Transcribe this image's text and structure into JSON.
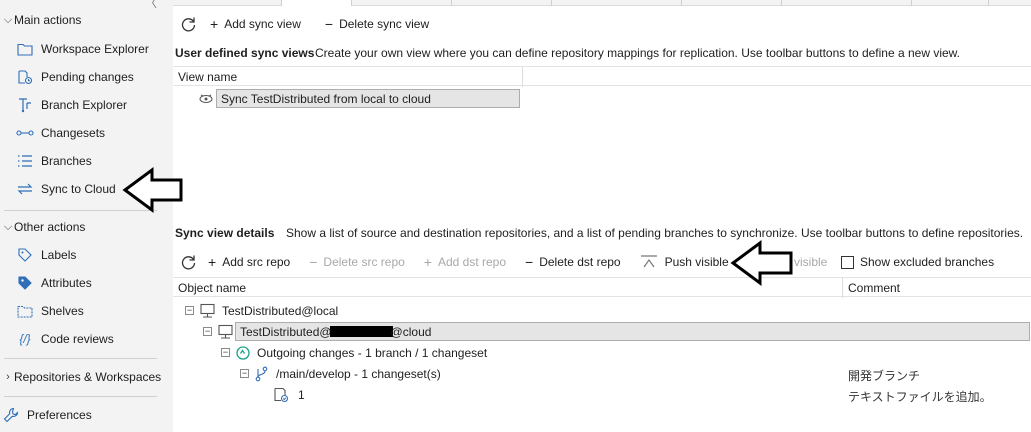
{
  "sidebar": {
    "main_actions_label": "Main actions",
    "main_items": [
      {
        "label": "Workspace Explorer",
        "icon": "folder-icon"
      },
      {
        "label": "Pending changes",
        "icon": "pending-changes-icon"
      },
      {
        "label": "Branch Explorer",
        "icon": "branch-explorer-icon"
      },
      {
        "label": "Changesets",
        "icon": "changesets-icon"
      },
      {
        "label": "Branches",
        "icon": "branches-list-icon"
      },
      {
        "label": "Sync to Cloud",
        "icon": "sync-icon"
      }
    ],
    "other_actions_label": "Other actions",
    "other_items": [
      {
        "label": "Labels",
        "icon": "label-tag-icon"
      },
      {
        "label": "Attributes",
        "icon": "attributes-tag-icon"
      },
      {
        "label": "Shelves",
        "icon": "shelves-icon"
      },
      {
        "label": "Code reviews",
        "icon": "code-review-icon"
      }
    ],
    "repos_label": "Repositories & Workspaces",
    "preferences_label": "Preferences"
  },
  "top_toolbar": {
    "add_sync_view": "Add sync view",
    "delete_sync_view": "Delete sync view"
  },
  "user_views": {
    "title": "User defined sync views",
    "description": "Create your own view where you can define repository mappings for replication. Use toolbar buttons to define a new view.",
    "column_header": "View name",
    "rows": [
      "Sync TestDistributed from local to cloud"
    ]
  },
  "details": {
    "title": "Sync view details",
    "description": "Show a list of source and destination repositories, and a list of pending branches to synchronize. Use toolbar buttons to define repositories.",
    "toolbar": {
      "add_src_repo": "Add src repo",
      "delete_src_repo": "Delete src repo",
      "add_dst_repo": "Add dst repo",
      "delete_dst_repo": "Delete dst repo",
      "push_visible": "Push visible",
      "pull_visible_fragment": "visible",
      "show_excluded_branches": "Show excluded branches"
    },
    "columns": {
      "object_name": "Object name",
      "comment": "Comment"
    },
    "tree": {
      "src_repo": "TestDistributed@local",
      "dst_repo_prefix": "TestDistributed@",
      "dst_repo_suffix": "@cloud",
      "outgoing": "Outgoing changes - 1 branch / 1 changeset",
      "branch": "/main/develop - 1 changeset(s)",
      "branch_comment": "開発ブランチ",
      "changeset": "1",
      "changeset_comment": "テキストファイルを追加。"
    }
  },
  "colors": {
    "sidebar_bg": "#f3f3f3",
    "selection_bg": "#e5e5e5",
    "accent_teal": "#18a38a",
    "icon_blue": "#2f6fb8"
  }
}
